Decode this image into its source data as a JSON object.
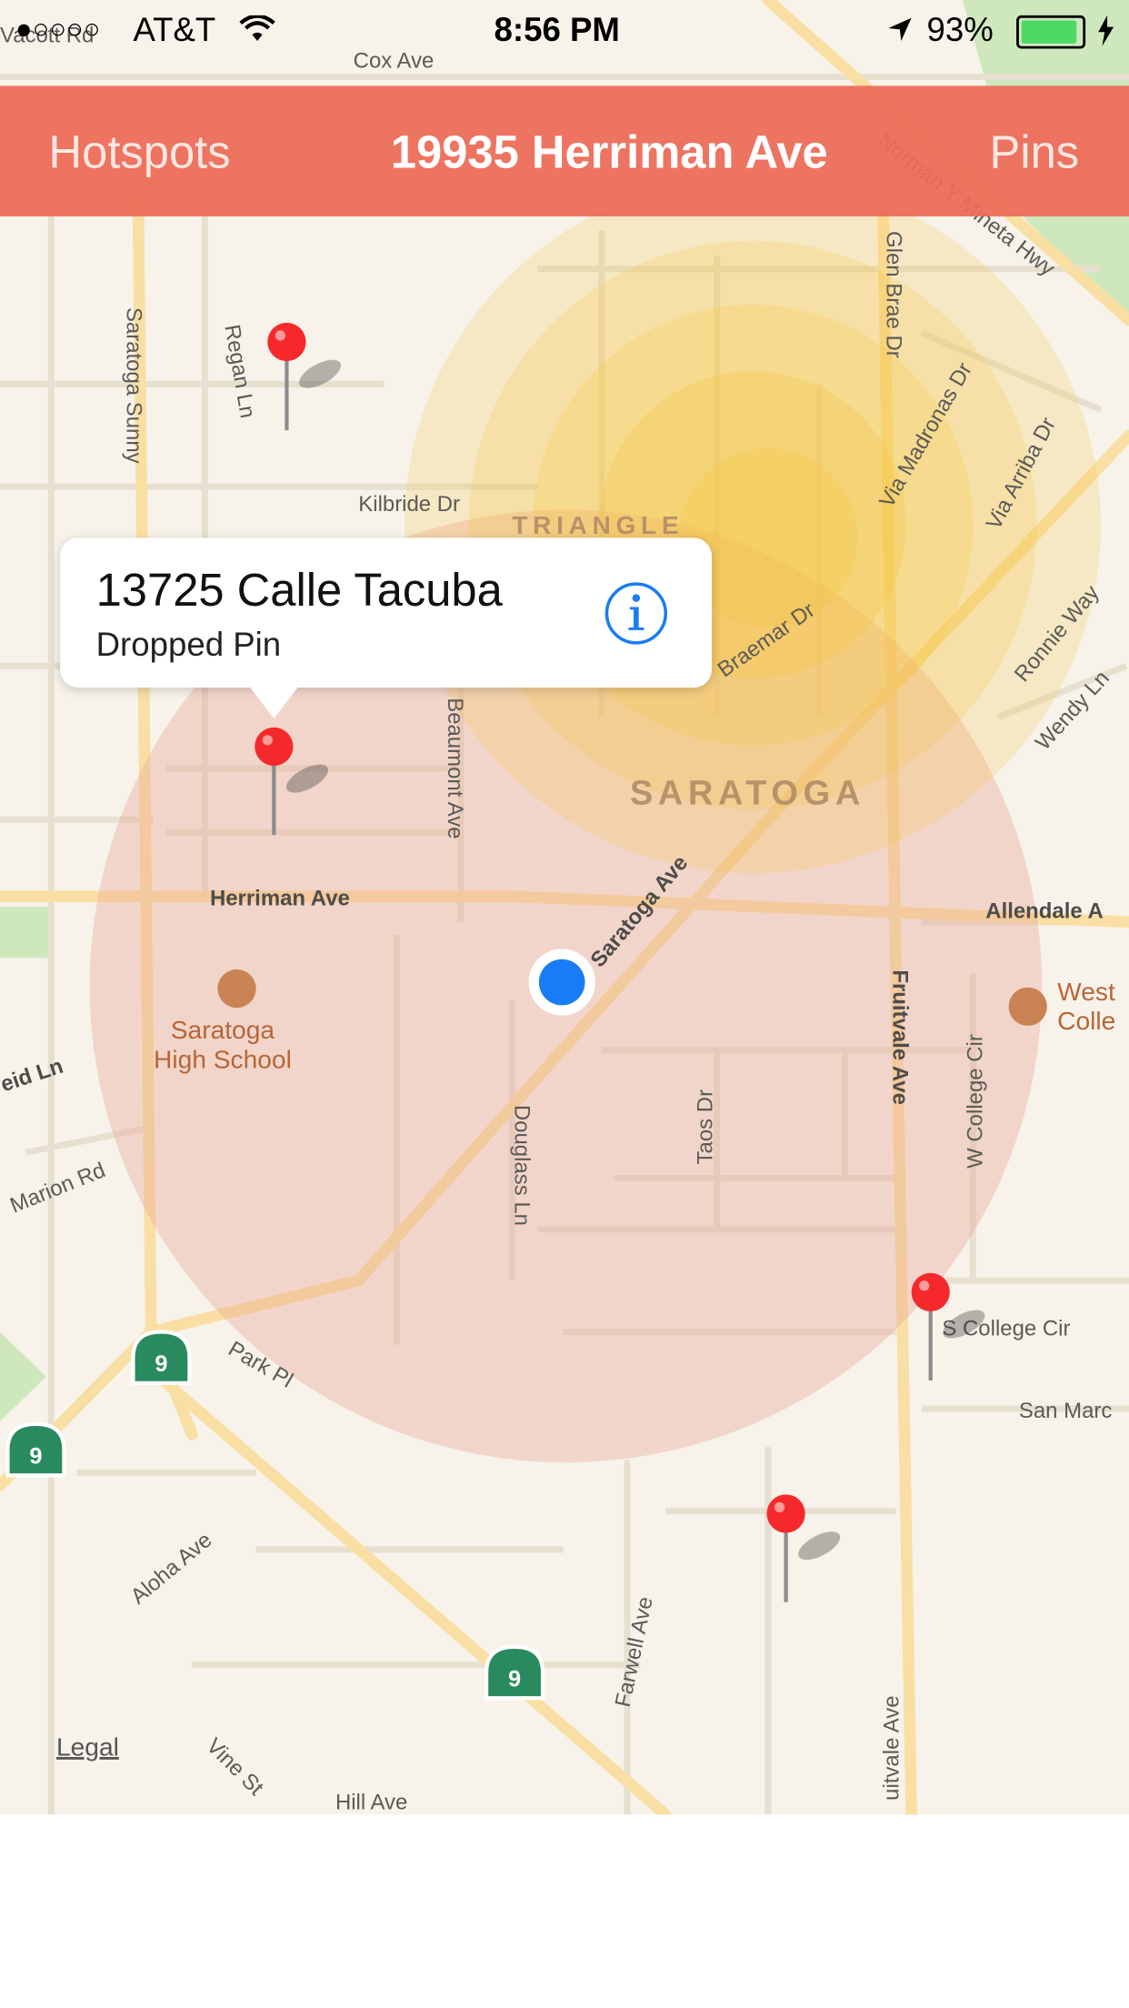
{
  "status_bar": {
    "signal": "●○○○○",
    "carrier": "AT&T",
    "time": "8:56 PM",
    "battery": "93%"
  },
  "nav": {
    "left_label": "Hotspots",
    "title": "19935 Herriman Ave",
    "right_label": "Pins"
  },
  "callout": {
    "title": "13725 Calle Tacuba",
    "subtitle": "Dropped Pin",
    "info_icon": "info-icon"
  },
  "map": {
    "city_label": "SARATOGA",
    "area_label": "TRIANGLE",
    "school_label": "Saratoga\nHigh School",
    "college_label": "West\nColle",
    "route_shield": "9",
    "streets": {
      "cox": "Cox Ave",
      "vacott": "Vacott Rd",
      "saratoga_sunny": "Saratoga Sunny",
      "regan": "Regan Ln",
      "kilbride": "Kilbride Dr",
      "glen_brae": "Glen Brae Dr",
      "norman": "Norman Y Mineta Hwy",
      "via_madronas": "Via Madronas Dr",
      "via_arriba": "Via Arriba Dr",
      "ronnie": "Ronnie Way",
      "wendy": "Wendy Ln",
      "braemar": "Braemar Dr",
      "beaumont": "Beaumont Ave",
      "herriman": "Herriman Ave",
      "saratoga_ave": "Saratoga Ave",
      "allendale": "Allendale A",
      "fruitvale": "Fruitvale Ave",
      "fruitvale2": "uitvale Ave",
      "w_college": "W College Cir",
      "douglass": "Douglass Ln",
      "taos": "Taos Dr",
      "reid": "eid Ln",
      "marion": "Marion Rd",
      "park": "Park Pl",
      "s_college": "S College Cir",
      "san_marcos": "San Marc",
      "aloha": "Aloha Ave",
      "farwell": "Farwell Ave",
      "vine": "Vine St",
      "hill": "Hill Ave"
    },
    "legal": "Legal"
  },
  "colors": {
    "nav_bar": "#ec6d5a",
    "hotspot_red": "#e9a596",
    "hotspot_yellow": "#f6c640",
    "user_location": "#1a7cf5",
    "pin": "#f5292b"
  }
}
